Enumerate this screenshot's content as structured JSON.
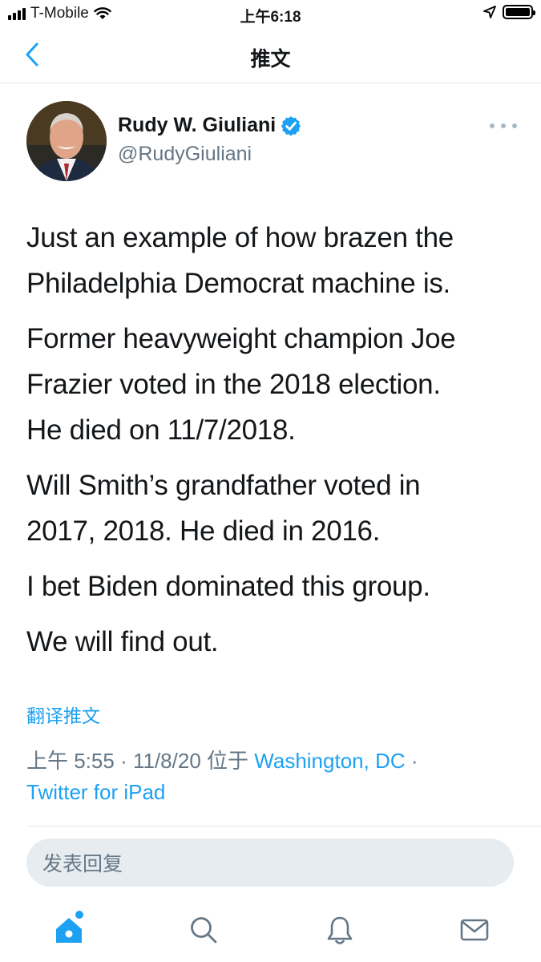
{
  "status_bar": {
    "carrier": "T-Mobile",
    "time": "上午6:18"
  },
  "nav": {
    "title": "推文",
    "back_icon": "chevron-left-icon"
  },
  "tweet": {
    "author_name": "Rudy W. Giuliani",
    "author_handle": "@RudyGiuliani",
    "verified": true,
    "paragraphs": [
      [
        "Just an example of how brazen the",
        "Philadelphia Democrat machine is."
      ],
      [
        "Former heavyweight champion Joe",
        "Frazier voted in the 2018 election.",
        "He died on 11/7/2018."
      ],
      [
        "Will Smith’s grandfather voted in",
        "2017, 2018. He died in 2016."
      ],
      [
        "I bet Biden dominated this group."
      ],
      [
        "We will find out."
      ]
    ],
    "translate_label": "翻译推文",
    "time": "上午 5:55",
    "sep": "·",
    "date": "11/8/20",
    "location_prefix": "位于",
    "location": "Washington, DC",
    "source": "Twitter for iPad"
  },
  "reply": {
    "placeholder": "发表回复"
  },
  "tab_bar": {
    "items": [
      "home-icon",
      "search-icon",
      "bell-icon",
      "mail-icon"
    ]
  },
  "colors": {
    "accent": "#1da1f2",
    "muted": "#657786",
    "text": "#14171a",
    "divider": "#e1e8ed"
  }
}
